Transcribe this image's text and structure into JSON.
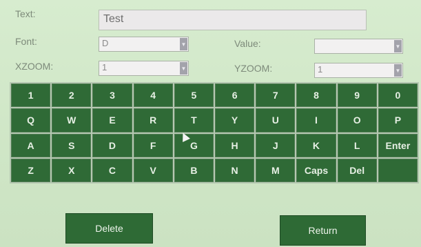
{
  "form": {
    "text_label": "Text:",
    "text_value": "Test",
    "font_label": "Font:",
    "font_value": "D",
    "value_label": "Value:",
    "value_value": "",
    "xzoom_label": "XZOOM:",
    "xzoom_value": "1",
    "yzoom_label": "YZOOM:",
    "yzoom_value": "1"
  },
  "keyboard": {
    "rows": [
      [
        "1",
        "2",
        "3",
        "4",
        "5",
        "6",
        "7",
        "8",
        "9",
        "0"
      ],
      [
        "Q",
        "W",
        "E",
        "R",
        "T",
        "Y",
        "U",
        "I",
        "O",
        "P"
      ],
      [
        "A",
        "S",
        "D",
        "F",
        "G",
        "H",
        "J",
        "K",
        "L",
        "Enter"
      ],
      [
        "Z",
        "X",
        "C",
        "V",
        "B",
        "N",
        "M",
        "Caps",
        "Del",
        ""
      ]
    ]
  },
  "buttons": {
    "delete_label": "Delete",
    "return_label": "Return"
  },
  "icons": {
    "dropdown": "chevron-down-icon",
    "pointer": "mouse-pointer-icon"
  },
  "colors": {
    "key_bg": "#2f6a36",
    "background": "#d7eccf"
  }
}
